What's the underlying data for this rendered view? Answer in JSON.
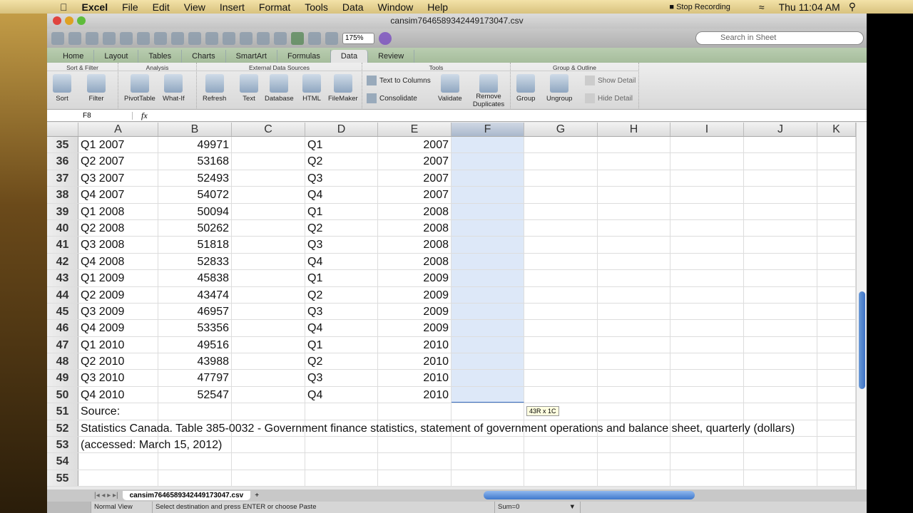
{
  "menubar": {
    "items": [
      "Excel",
      "File",
      "Edit",
      "View",
      "Insert",
      "Format",
      "Tools",
      "Data",
      "Window",
      "Help"
    ],
    "stop_recording": "Stop Recording",
    "clock": "Thu 11:04 AM"
  },
  "window": {
    "title": "cansim7646589342449173047.csv"
  },
  "toolbar": {
    "zoom": "175%",
    "search_placeholder": "Search in Sheet"
  },
  "tabs": [
    "Home",
    "Layout",
    "Tables",
    "Charts",
    "SmartArt",
    "Formulas",
    "Data",
    "Review"
  ],
  "active_tab": "Data",
  "ribbon": {
    "groups": [
      "Sort & Filter",
      "Analysis",
      "External Data Sources",
      "Tools",
      "Group & Outline"
    ],
    "buttons": {
      "sort": "Sort",
      "filter": "Filter",
      "pivot": "PivotTable",
      "whatif": "What-If",
      "refresh": "Refresh",
      "text": "Text",
      "database": "Database",
      "html": "HTML",
      "filemaker": "FileMaker",
      "text_to_columns": "Text to Columns",
      "consolidate": "Consolidate",
      "validate": "Validate",
      "remove_duplicates": "Remove Duplicates",
      "group": "Group",
      "ungroup": "Ungroup",
      "show_detail": "Show Detail",
      "hide_detail": "Hide Detail"
    }
  },
  "formula_bar": {
    "name_box": "F8",
    "fx": "fx",
    "value": ""
  },
  "columns": [
    "A",
    "B",
    "C",
    "D",
    "E",
    "F",
    "G",
    "H",
    "I",
    "J",
    "K"
  ],
  "selected_column": "F",
  "rows": [
    {
      "n": 35,
      "a": "Q1 2007",
      "b": "49971",
      "d": "Q1",
      "e": "2007"
    },
    {
      "n": 36,
      "a": "Q2 2007",
      "b": "53168",
      "d": "Q2",
      "e": "2007"
    },
    {
      "n": 37,
      "a": "Q3 2007",
      "b": "52493",
      "d": "Q3",
      "e": "2007"
    },
    {
      "n": 38,
      "a": "Q4 2007",
      "b": "54072",
      "d": "Q4",
      "e": "2007"
    },
    {
      "n": 39,
      "a": "Q1 2008",
      "b": "50094",
      "d": "Q1",
      "e": "2008"
    },
    {
      "n": 40,
      "a": "Q2 2008",
      "b": "50262",
      "d": "Q2",
      "e": "2008"
    },
    {
      "n": 41,
      "a": "Q3 2008",
      "b": "51818",
      "d": "Q3",
      "e": "2008"
    },
    {
      "n": 42,
      "a": "Q4 2008",
      "b": "52833",
      "d": "Q4",
      "e": "2008"
    },
    {
      "n": 43,
      "a": "Q1 2009",
      "b": "45838",
      "d": "Q1",
      "e": "2009"
    },
    {
      "n": 44,
      "a": "Q2 2009",
      "b": "43474",
      "d": "Q2",
      "e": "2009"
    },
    {
      "n": 45,
      "a": "Q3 2009",
      "b": "46957",
      "d": "Q3",
      "e": "2009"
    },
    {
      "n": 46,
      "a": "Q4 2009",
      "b": "53356",
      "d": "Q4",
      "e": "2009"
    },
    {
      "n": 47,
      "a": "Q1 2010",
      "b": "49516",
      "d": "Q1",
      "e": "2010"
    },
    {
      "n": 48,
      "a": "Q2 2010",
      "b": "43988",
      "d": "Q2",
      "e": "2010"
    },
    {
      "n": 49,
      "a": "Q3 2010",
      "b": "47797",
      "d": "Q3",
      "e": "2010"
    },
    {
      "n": 50,
      "a": "Q4 2010",
      "b": "52547",
      "d": "Q4",
      "e": "2010"
    },
    {
      "n": 51,
      "a": "Source:"
    },
    {
      "n": 52,
      "a": "Statistics Canada. Table 385-0032 - Government finance statistics, statement of government operations and balance sheet, quarterly (dollars)"
    },
    {
      "n": 53,
      "a": "(accessed: March 15, 2012)"
    },
    {
      "n": 54
    },
    {
      "n": 55
    }
  ],
  "selection_tooltip": "43R x 1C",
  "sheet_tab": "cansim7646589342449173047.csv",
  "status": {
    "view": "Normal View",
    "message": "Select destination and press ENTER or choose Paste",
    "sum": "Sum=0"
  }
}
